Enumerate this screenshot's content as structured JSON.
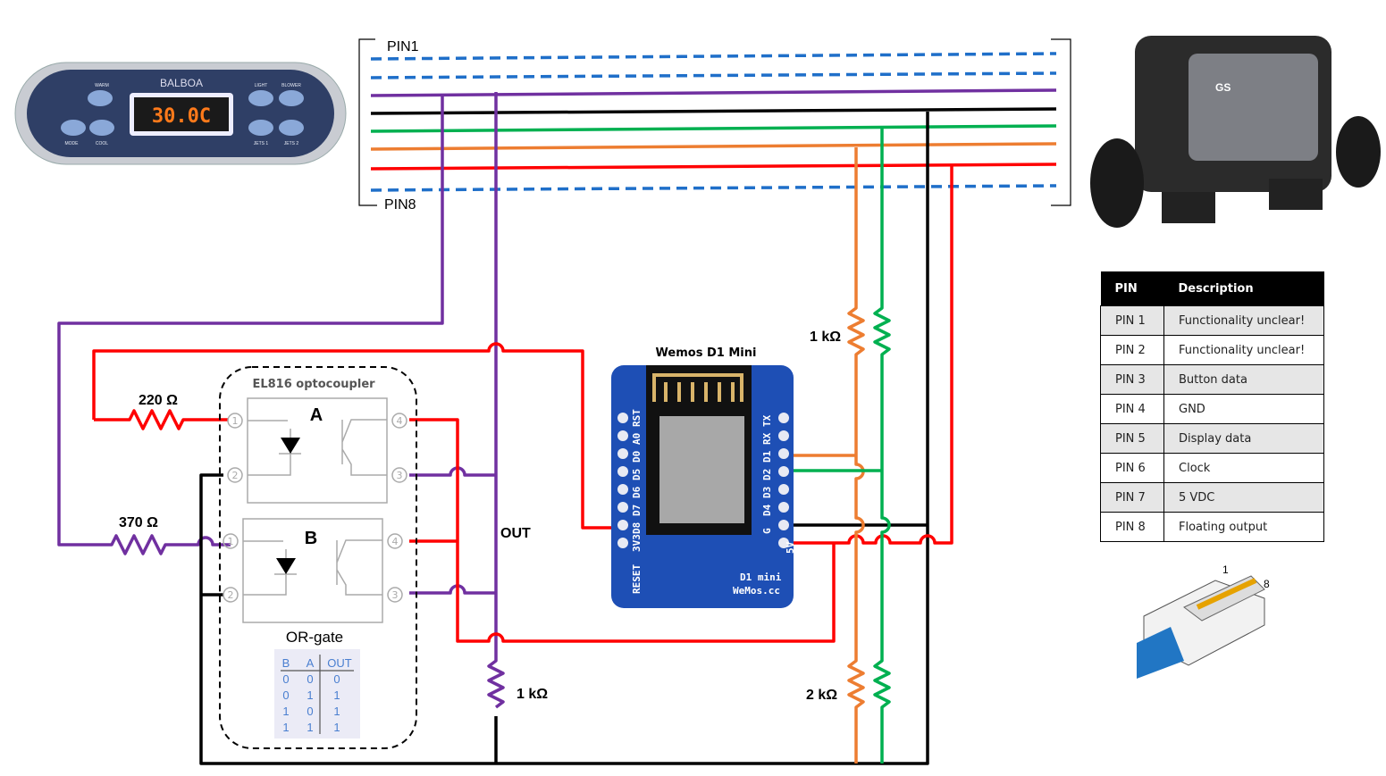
{
  "bus": {
    "pin_first": "PIN1",
    "pin_last": "PIN8"
  },
  "keypad": {
    "brand": "BALBOA",
    "display": "30.0C",
    "buttons": [
      "WARM",
      "COOL",
      "MODE",
      "LIGHT",
      "BLOWER",
      "JETS 1",
      "JETS 2"
    ]
  },
  "spa_pack": {
    "brand": "GS"
  },
  "optocoupler": {
    "title": "EL816 optocoupler",
    "channel_a": "A",
    "channel_b": "B",
    "pins": [
      "1",
      "2",
      "3",
      "4"
    ],
    "gate_label": "OR-gate"
  },
  "truth_table": {
    "headers": [
      "B",
      "A",
      "OUT"
    ],
    "rows": [
      [
        "0",
        "0",
        "0"
      ],
      [
        "0",
        "1",
        "1"
      ],
      [
        "1",
        "0",
        "1"
      ],
      [
        "1",
        "1",
        "1"
      ]
    ]
  },
  "resistors": {
    "r220": "220 Ω",
    "r370": "370 Ω",
    "r1k_out": "1 kΩ",
    "r1k_top": "1 kΩ",
    "r2k": "2 kΩ"
  },
  "out_label": "OUT",
  "wemos": {
    "title": "Wemos D1 Mini",
    "left_pins": [
      "RST",
      "A0",
      "D0",
      "D5",
      "D6",
      "D7",
      "D8",
      "3V3"
    ],
    "right_pins": [
      "TX",
      "RX",
      "D1",
      "D2",
      "D3",
      "D4",
      "G",
      "5V"
    ],
    "reset": "RESET",
    "logo": "D1 mini",
    "site": "WeMos.cc"
  },
  "pin_table": {
    "headers": [
      "PIN",
      "Description"
    ],
    "rows": [
      [
        "PIN 1",
        "Functionality unclear!"
      ],
      [
        "PIN 2",
        "Functionality unclear!"
      ],
      [
        "PIN 3",
        "Button data"
      ],
      [
        "PIN 4",
        "GND"
      ],
      [
        "PIN 5",
        "Display data"
      ],
      [
        "PIN 6",
        "Clock"
      ],
      [
        "PIN 7",
        "5 VDC"
      ],
      [
        "PIN 8",
        "Floating output"
      ]
    ]
  },
  "connector": {
    "pin_first": "1",
    "pin_last": "8"
  },
  "colors": {
    "blue": "#1f6fc9",
    "purple": "#7030a0",
    "black": "#000000",
    "green": "#00b050",
    "orange": "#ed7d31",
    "red": "#ff0000",
    "board": "#1e4fb5"
  }
}
